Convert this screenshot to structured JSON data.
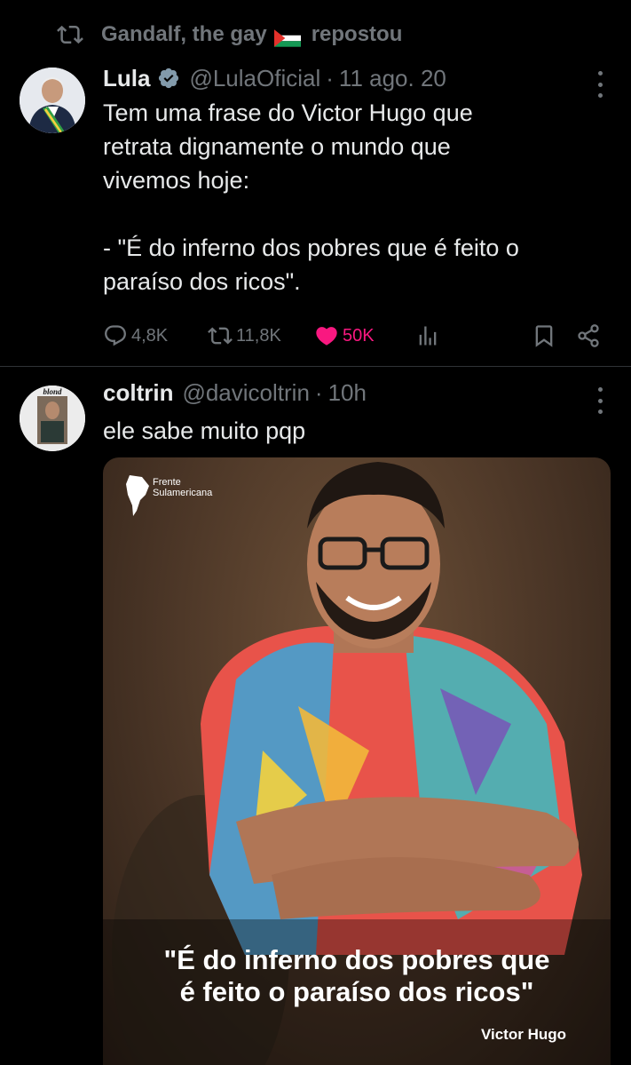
{
  "repost": {
    "text_before": "Gandalf, the gay",
    "text_after": "repostou"
  },
  "post1": {
    "name": "Lula",
    "handle": "@LulaOficial",
    "time": "11 ago. 20",
    "text": "Tem uma frase do Victor Hugo que\nretrata dignamente o mundo que\nvivemos hoje:\n\n- \"É do inferno dos pobres que é feito o\nparaíso dos ricos\".",
    "stats": {
      "replies": "4,8K",
      "reposts": "11,8K",
      "likes": "50K"
    }
  },
  "post2": {
    "name": "coltrin",
    "handle": "@davicoltrin",
    "time": "10h",
    "text": "ele sabe muito pqp",
    "avatar_label": "blond",
    "media": {
      "brand": "Frente\nSulamericana",
      "quote_line1": "\"É do inferno dos pobres que",
      "quote_line2": "é feito o paraíso dos ricos\"",
      "author": "Victor Hugo"
    }
  },
  "colors": {
    "background": "#000000",
    "text": "#e7e9ea",
    "muted": "#71767b",
    "like": "#f91880",
    "verified": "#829aab"
  }
}
